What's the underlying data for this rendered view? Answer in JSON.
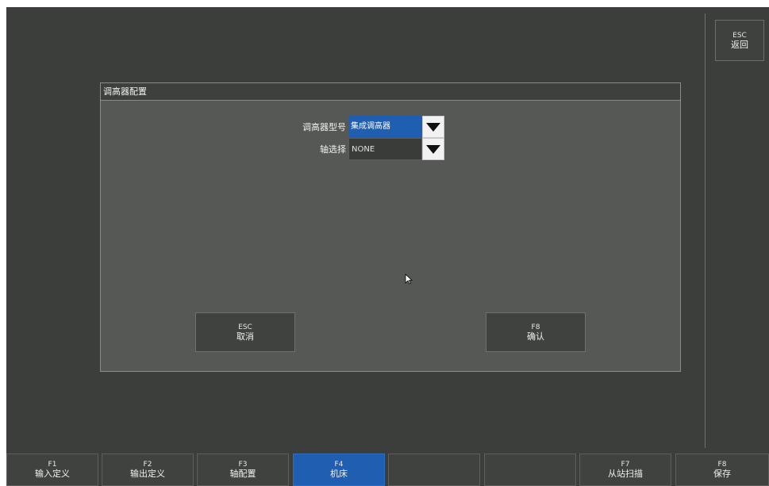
{
  "side_button": {
    "key": "ESC",
    "label": "返回"
  },
  "dialog": {
    "title": "调高器配置",
    "rows": [
      {
        "label": "调高器型号",
        "value": "集成调高器"
      },
      {
        "label": "轴选择",
        "value": "NONE"
      }
    ],
    "cancel": {
      "key": "ESC",
      "label": "取消"
    },
    "confirm": {
      "key": "F8",
      "label": "确认"
    }
  },
  "fkeys": [
    {
      "key": "F1",
      "label": "输入定义"
    },
    {
      "key": "F2",
      "label": "输出定义"
    },
    {
      "key": "F3",
      "label": "轴配置"
    },
    {
      "key": "F4",
      "label": "机床"
    },
    {
      "key": "",
      "label": ""
    },
    {
      "key": "",
      "label": ""
    },
    {
      "key": "F7",
      "label": "从站扫描"
    },
    {
      "key": "F8",
      "label": "保存"
    }
  ],
  "colors": {
    "background": "#3b3e3b",
    "dialog": "#565856",
    "accent": "#1f5eb0"
  },
  "icons": {
    "cursor": "mouse-pointer-icon",
    "dropdown": "dropdown-arrow-icon"
  }
}
